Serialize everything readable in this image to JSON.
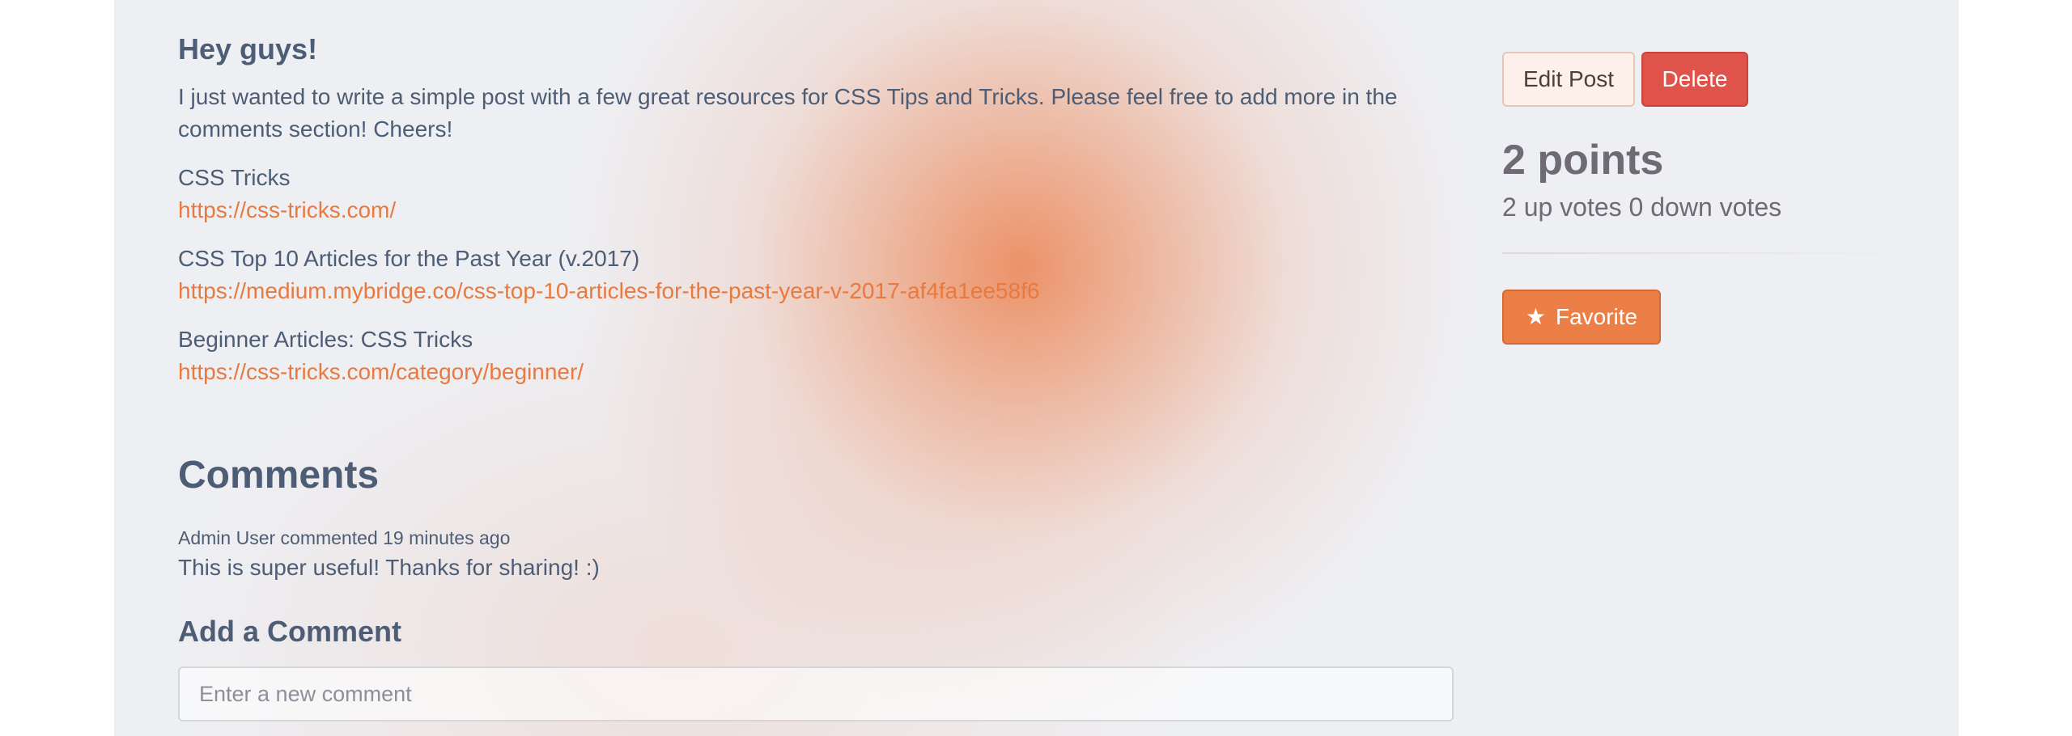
{
  "post": {
    "title": "Hey guys!",
    "body": "I just wanted to write a simple post with a few great resources for CSS Tips and Tricks. Please feel free to add more in the comments section! Cheers!",
    "resources": [
      {
        "name": "CSS Tricks",
        "url": "https://css-tricks.com/"
      },
      {
        "name": "CSS Top 10 Articles for the Past Year (v.2017)",
        "url": "https://medium.mybridge.co/css-top-10-articles-for-the-past-year-v-2017-af4fa1ee58f6"
      },
      {
        "name": "Beginner Articles: CSS Tricks",
        "url": "https://css-tricks.com/category/beginner/"
      }
    ]
  },
  "comments": {
    "heading": "Comments",
    "items": [
      {
        "meta": "Admin User commented 19 minutes ago",
        "text": "This is super useful! Thanks for sharing! :)"
      }
    ]
  },
  "add_comment": {
    "heading": "Add a Comment",
    "placeholder": "Enter a new comment"
  },
  "sidebar": {
    "edit_label": "Edit Post",
    "delete_label": "Delete",
    "points": "2 points",
    "votes": "2 up votes 0 down votes",
    "favorite_label": "Favorite",
    "favorite_icon": "star-icon"
  },
  "colors": {
    "accent": "#ec7f45",
    "link": "#e8793f",
    "danger": "#df534b",
    "text": "#4c5d75"
  }
}
